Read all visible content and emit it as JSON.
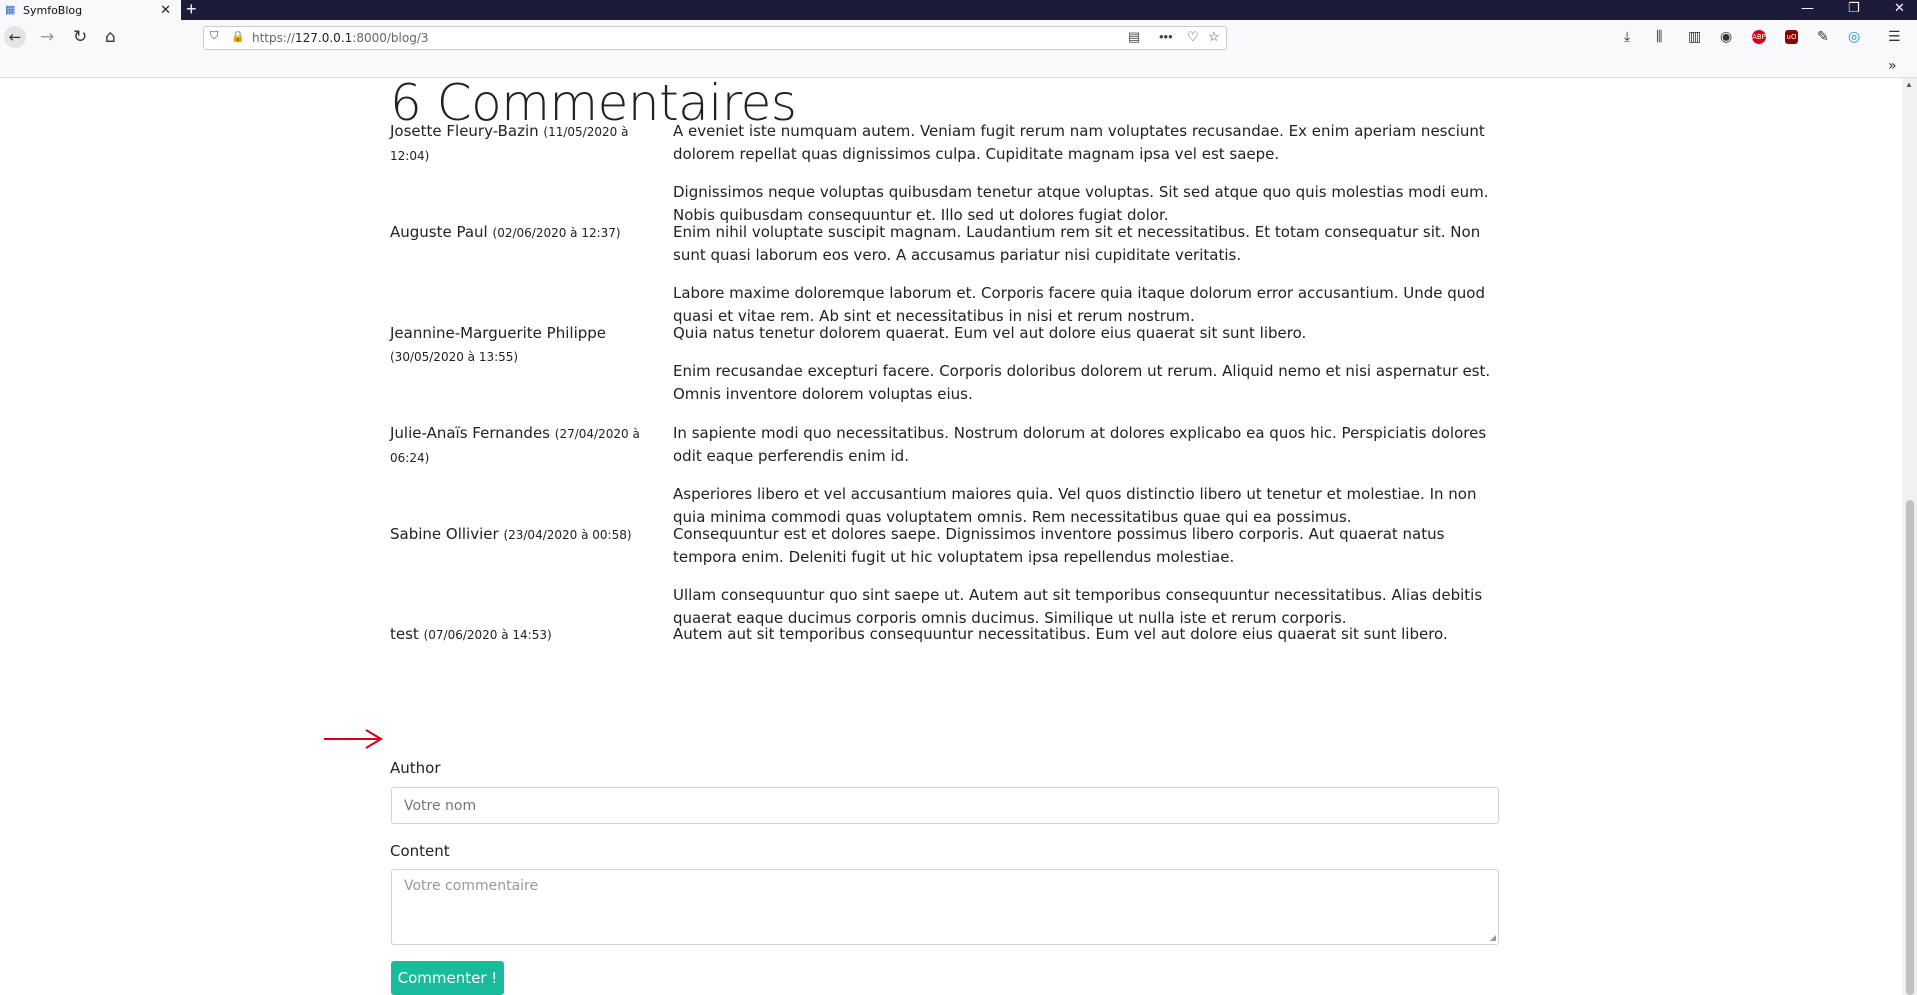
{
  "browser": {
    "tab_title": "SymfoBlog",
    "tab_close": "✕",
    "new_tab": "+",
    "url_host": "127.0.0.1",
    "url_prefix": "https://",
    "url_suffix": ":8000/blog/3",
    "window_controls": [
      "—",
      "❐",
      "✕"
    ]
  },
  "page": {
    "heading": "6 Commentaires",
    "comments": [
      {
        "author": "Josette Fleury-Bazin",
        "date": "(11/05/2020 à 12:04)",
        "paragraphs": [
          "A eveniet iste numquam autem. Veniam fugit rerum nam voluptates recusandae. Ex enim aperiam nesciunt dolorem repellat quas dignissimos culpa. Cupiditate magnam ipsa vel est saepe.",
          "Dignissimos neque voluptas quibusdam tenetur atque voluptas. Sit sed atque quo quis molestias modi eum. Nobis quibusdam consequuntur et. Illo sed ut dolores fugiat dolor."
        ]
      },
      {
        "author": "Auguste Paul",
        "date": "(02/06/2020 à 12:37)",
        "paragraphs": [
          "Enim nihil voluptate suscipit magnam. Laudantium rem sit et necessitatibus. Et totam consequatur sit. Non sunt quasi laborum eos vero. A accusamus pariatur nisi cupiditate veritatis.",
          "Labore maxime doloremque laborum et. Corporis facere quia itaque dolorum error accusantium. Unde quod quasi et vitae rem. Ab sint et necessitatibus in nisi et rerum nostrum."
        ]
      },
      {
        "author": "Jeannine-Marguerite Philippe",
        "date": "(30/05/2020 à 13:55)",
        "paragraphs": [
          "Quia natus tenetur dolorem quaerat. Eum vel aut dolore eius quaerat sit sunt libero.",
          "Enim recusandae excepturi facere. Corporis doloribus dolorem ut rerum. Aliquid nemo et nisi aspernatur est. Omnis inventore dolorem voluptas eius."
        ]
      },
      {
        "author": "Julie-Anaïs Fernandes",
        "date": "(27/04/2020 à 06:24)",
        "paragraphs": [
          "In sapiente modi quo necessitatibus. Nostrum dolorum at dolores explicabo ea quos hic. Perspiciatis dolores odit eaque perferendis enim id.",
          "Asperiores libero et vel accusantium maiores quia. Vel quos distinctio libero ut tenetur et molestiae. In non quia minima commodi quas voluptatem omnis. Rem necessitatibus quae qui ea possimus."
        ]
      },
      {
        "author": "Sabine Ollivier",
        "date": "(23/04/2020 à 00:58)",
        "paragraphs": [
          "Consequuntur est et dolores saepe. Dignissimos inventore possimus libero corporis. Aut quaerat natus tempora enim. Deleniti fugit ut hic voluptatem ipsa repellendus molestiae.",
          "Ullam consequuntur quo sint saepe ut. Autem aut sit temporibus consequuntur necessitatibus. Alias debitis quaerat eaque ducimus corporis omnis ducimus. Similique ut nulla iste et rerum corporis."
        ]
      },
      {
        "author": "test",
        "date": "(07/06/2020 à 14:53)",
        "paragraphs": [
          "Autem aut sit temporibus consequuntur necessitatibus. Eum vel aut dolore eius quaerat sit sunt libero."
        ]
      }
    ],
    "form": {
      "author_label": "Author",
      "author_placeholder": "Votre nom",
      "content_label": "Content",
      "content_placeholder": "Votre commentaire",
      "submit_label": "Commenter !"
    }
  },
  "colors": {
    "accent": "#18bc9c",
    "arrow": "#d0021b",
    "tabbar": "#1c1b3a"
  }
}
